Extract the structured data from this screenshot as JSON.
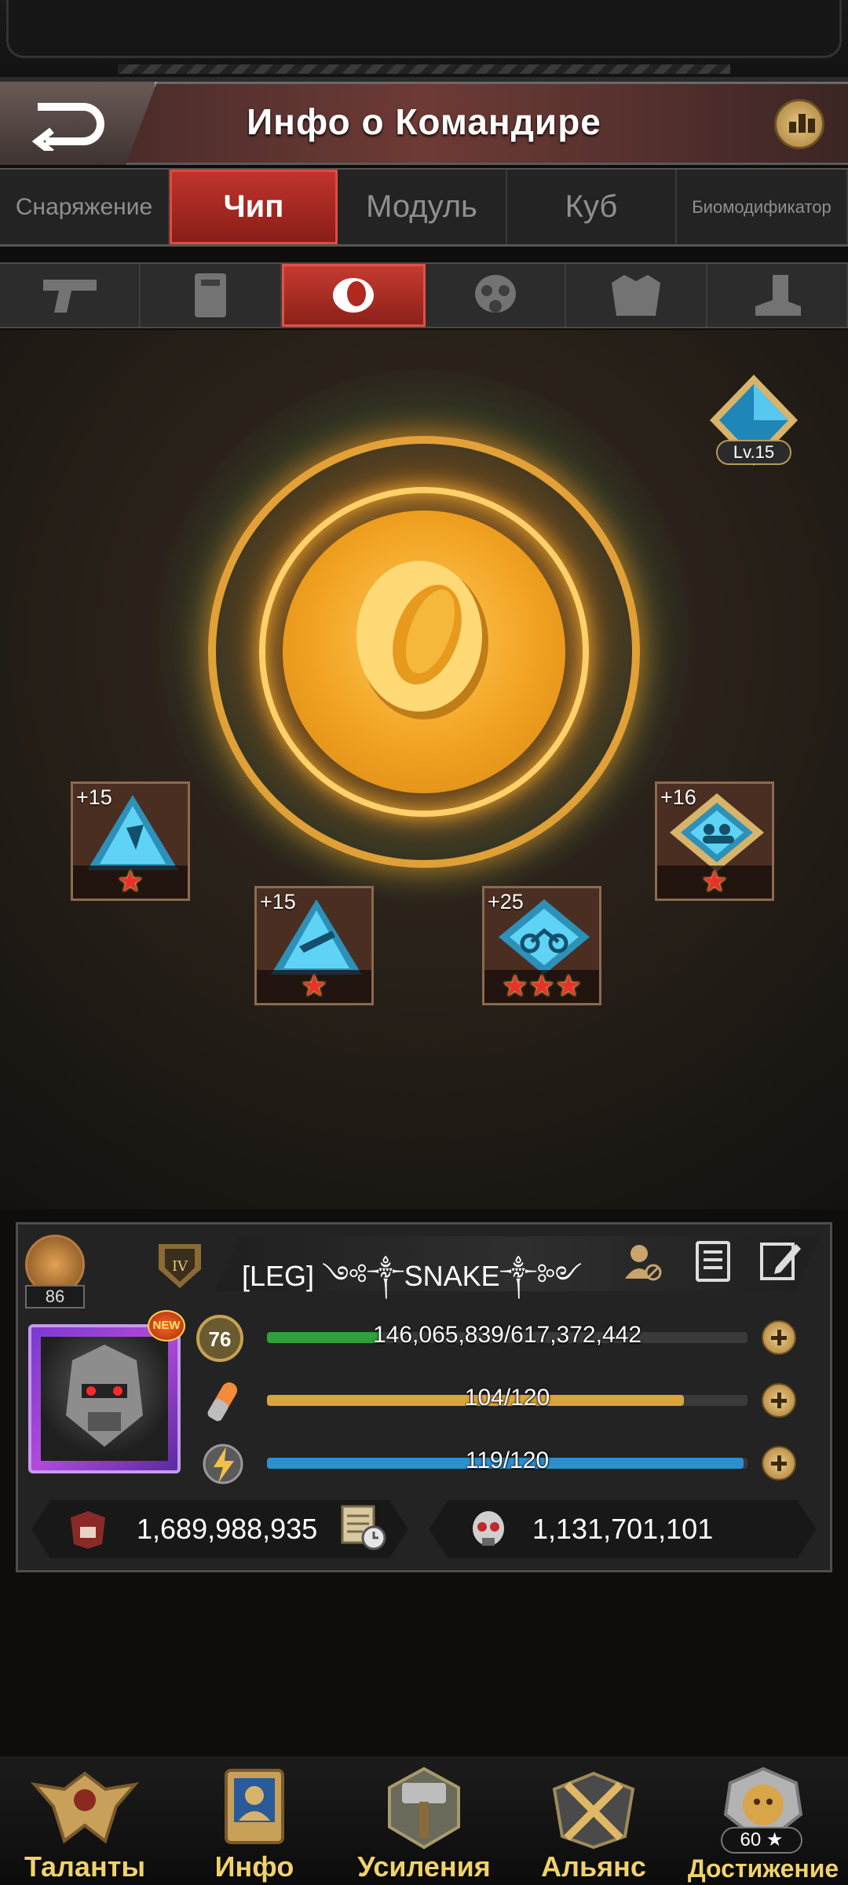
{
  "header": {
    "title": "Инфо о Командире"
  },
  "tabs": [
    {
      "label": "Снаряжение"
    },
    {
      "label": "Чип"
    },
    {
      "label": "Модуль"
    },
    {
      "label": "Куб"
    },
    {
      "label": "Биомодификатор"
    }
  ],
  "active_tab": "Чип",
  "slot_icons": [
    "pistol-icon",
    "shield-icon",
    "ring-icon",
    "gas-mask-icon",
    "armor-vest-icon",
    "boot-icon"
  ],
  "active_slot": "ring-icon",
  "chip_level": "Lv.15",
  "chips": [
    {
      "plus": "+15",
      "stars": 1,
      "icon": "pistol-chip-icon"
    },
    {
      "plus": "+15",
      "stars": 1,
      "icon": "rifle-chip-icon"
    },
    {
      "plus": "+25",
      "stars": 3,
      "icon": "motorcycle-chip-icon"
    },
    {
      "plus": "+16",
      "stars": 1,
      "icon": "troops-chip-icon"
    }
  ],
  "commander": {
    "level_badge": "86",
    "name": "[LEG] ༺༒SNAKE༒༻",
    "portrait_badge": "NEW",
    "experience_level": "76",
    "experience": "146,065,839/617,372,442",
    "experience_fill": 0.237,
    "stamina": "104/120",
    "stamina_fill": 0.867,
    "energy": "119/120",
    "energy_fill": 0.992,
    "power": "1,689,988,935",
    "kills": "1,131,701,101"
  },
  "colors": {
    "accent_red": "#c0342c",
    "nav_gold": "#f1d26a",
    "exp_bar": "#2fa03a",
    "stamina_bar": "#d8a63c",
    "energy_bar": "#2b8fd0"
  },
  "navbar": [
    {
      "label": "Таланты"
    },
    {
      "label": "Инфо"
    },
    {
      "label": "Усиления"
    },
    {
      "label": "Альянс"
    },
    {
      "label": "Достижение",
      "count": "60 ★"
    }
  ]
}
